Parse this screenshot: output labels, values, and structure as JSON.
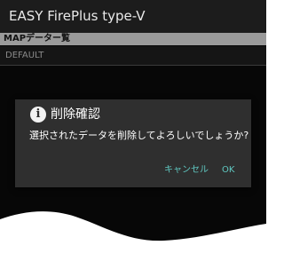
{
  "app": {
    "title": "EASY FirePlus type-V"
  },
  "section": {
    "label": "MAPデーター覧"
  },
  "list": {
    "items": [
      {
        "label": "DEFAULT"
      }
    ]
  },
  "dialog": {
    "icon": "info-icon",
    "icon_glyph": "i",
    "title": "削除確認",
    "message": "選択されたデータを削除してよろしいでしょうか?",
    "cancel_label": "キャンセル",
    "ok_label": "OK"
  },
  "colors": {
    "background": "#070707",
    "dialog": "#2f2f2f",
    "accent": "#5fc7c0",
    "section_header": "#9a9a9a"
  }
}
